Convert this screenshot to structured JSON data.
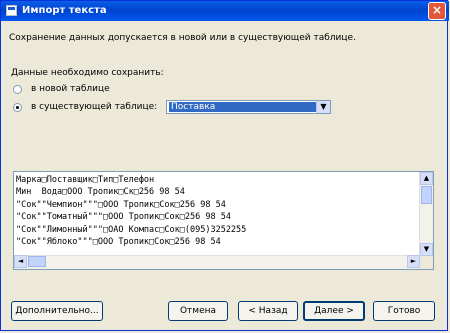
{
  "window": {
    "title": "Импорт текста",
    "close_glyph": "×"
  },
  "intro": "Сохранение данных допускается в новой или в существующей таблице.",
  "save_label": "Данные необходимо сохранить:",
  "options": {
    "new_table": "в новой таблице",
    "existing_table": "в существующей таблице:"
  },
  "selected_table": "Поставка",
  "preview_lines": [
    "Марка□Поставщик□Тип□Телефон",
    "Мин  Вода□ООО Тропик□Ск□256 98 54",
    "\"Сок\"\"Чемпион\"\"\"□ООО Тропик□Сок□256 98 54",
    "\"Сок\"\"Томатный\"\"\"□ООО Тропик□Сок□256 98 54",
    "\"Сок\"\"Лимонный\"\"\"□ОАО Компас□Сок□(095)3252255",
    "\"Сок\"\"Яблоко\"\"\"□ООО Тропик□Сок□256 98 54"
  ],
  "buttons": {
    "advanced": "Дополнительно...",
    "cancel": "Отмена",
    "back": "< Назад",
    "next": "Далее >",
    "finish": "Готово"
  },
  "scroll_glyphs": {
    "up": "▲",
    "down": "▼",
    "left": "◄",
    "right": "►"
  }
}
